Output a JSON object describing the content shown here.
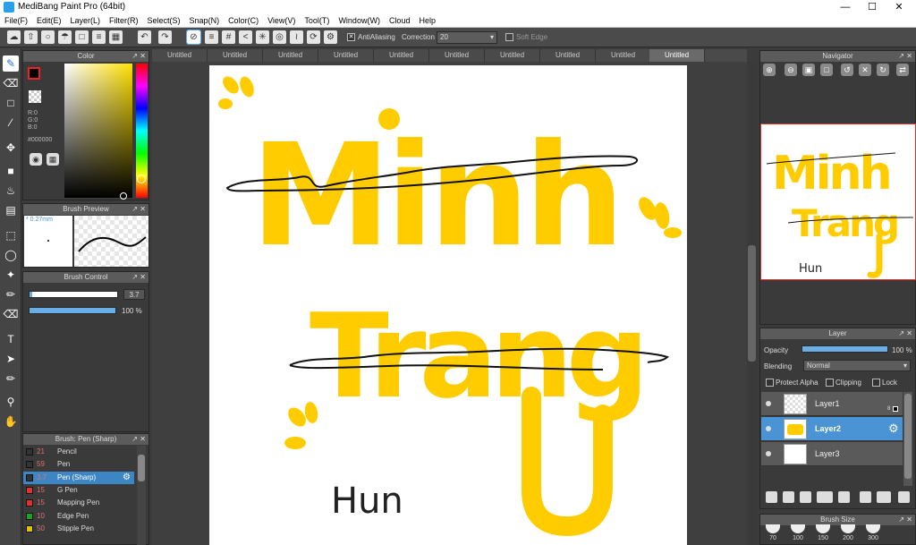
{
  "app": {
    "title": "MediBang Paint Pro (64bit)"
  },
  "menu": [
    "File(F)",
    "Edit(E)",
    "Layer(L)",
    "Filter(R)",
    "Select(S)",
    "Snap(N)",
    "Color(C)",
    "View(V)",
    "Tool(T)",
    "Window(W)",
    "Cloud",
    "Help"
  ],
  "toolbar": {
    "antialias_label": "AntiAliasing",
    "correction_label": "Correction",
    "correction_value": "20",
    "soft_edge_label": "Soft Edge"
  },
  "color_panel": {
    "title": "Color",
    "r": "R:0",
    "g": "G:0",
    "b": "B:0",
    "hex": "#000000",
    "fg": "#000000",
    "bg": "#ffffff"
  },
  "brush_preview": {
    "title": "Brush Preview",
    "size": "0.27mm"
  },
  "brush_control": {
    "title": "Brush Control",
    "size_value": "3.7",
    "opacity_value": "100 %",
    "size_fraction": 0.03,
    "opacity_fraction": 1.0
  },
  "brush_list": {
    "title": "Brush: Pen (Sharp)",
    "items": [
      {
        "size": "21",
        "name": "Pencil",
        "color": "#333333"
      },
      {
        "size": "59",
        "name": "Pen",
        "color": "#333333"
      },
      {
        "size": "3.7",
        "name": "Pen (Sharp)",
        "color": "#333333",
        "selected": true
      },
      {
        "size": "15",
        "name": "G Pen",
        "color": "#e03030"
      },
      {
        "size": "15",
        "name": "Mapping Pen",
        "color": "#e03030"
      },
      {
        "size": "10",
        "name": "Edge Pen",
        "color": "#20a020"
      },
      {
        "size": "50",
        "name": "Stipple Pen",
        "color": "#e0c000"
      }
    ]
  },
  "tabs": [
    "Untitled",
    "Untitled",
    "Untitled",
    "Untitled",
    "Untitled",
    "Untitled",
    "Untitled",
    "Untitled",
    "Untitled",
    "Untitled"
  ],
  "active_tab": 9,
  "canvas": {
    "word1": "Minh",
    "word2": "Trang",
    "signature": "Hun",
    "yellow": "#ffcc00"
  },
  "navigator": {
    "title": "Navigator"
  },
  "layer_panel": {
    "title": "Layer",
    "opacity_label": "Opacity",
    "opacity_value": "100 %",
    "opacity_fraction": 1.0,
    "blending_label": "Blending",
    "blending_value": "Normal",
    "protect_alpha": "Protect Alpha",
    "clipping": "Clipping",
    "lock": "Lock",
    "layers": [
      {
        "name": "Layer1",
        "selected": false
      },
      {
        "name": "Layer2",
        "selected": true
      },
      {
        "name": "Layer3",
        "selected": false
      }
    ],
    "layer1_badge": "8"
  },
  "brush_size": {
    "title": "Brush Size",
    "sizes": [
      "70",
      "100",
      "150",
      "200",
      "300"
    ]
  }
}
